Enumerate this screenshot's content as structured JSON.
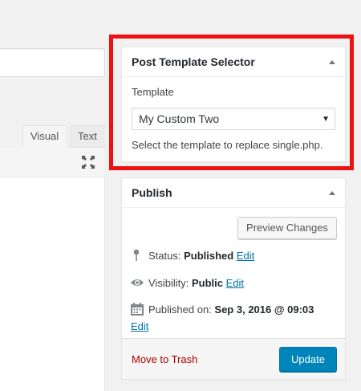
{
  "editor": {
    "tabs": [
      {
        "label": "Visual"
      },
      {
        "label": "Text"
      }
    ]
  },
  "template_box": {
    "title": "Post Template Selector",
    "toggle_icon": "caret-up-icon",
    "template_label": "Template",
    "selected_template": "My Custom Two",
    "help_text": "Select the template to replace single.php."
  },
  "publish_box": {
    "title": "Publish",
    "toggle_icon": "caret-up-icon",
    "preview_label": "Preview Changes",
    "status_label": "Status:",
    "status_value": "Published",
    "visibility_label": "Visibility:",
    "visibility_value": "Public",
    "published_label": "Published on:",
    "published_value": "Sep 3, 2016 @ 09:03",
    "edit_label": "Edit",
    "trash_label": "Move to Trash",
    "update_label": "Update"
  },
  "colors": {
    "highlight_border": "#ee1111",
    "primary_button": "#0085ba",
    "link": "#0073aa",
    "trash": "#aa0000"
  }
}
